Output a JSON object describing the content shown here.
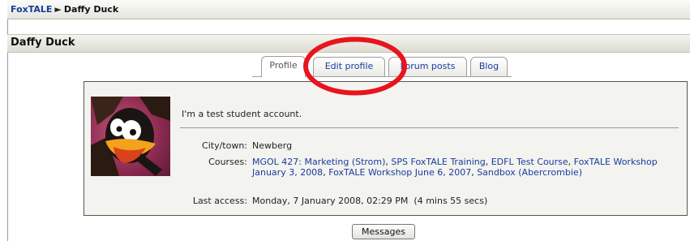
{
  "breadcrumb": {
    "root": "FoxTALE",
    "separator": "►",
    "current": "Daffy Duck"
  },
  "heading": "Daffy Duck",
  "tabs": [
    {
      "label": "Profile",
      "active": true
    },
    {
      "label": "Edit profile",
      "active": false
    },
    {
      "label": "Forum posts",
      "active": false
    },
    {
      "label": "Blog",
      "active": false
    }
  ],
  "profile": {
    "description": "I'm a test student account.",
    "city_label": "City/town:",
    "city_value": "Newberg",
    "courses_label": "Courses:",
    "courses": [
      "MGOL 427: Marketing (Strom)",
      "SPS FoxTALE Training",
      "EDFL Test Course",
      "FoxTALE Workshop January 3, 2008",
      "FoxTALE Workshop June 6, 2007",
      "Sandbox (Abercrombie)"
    ],
    "last_access_label": "Last access:",
    "last_access_value": "Monday, 7 January 2008, 02:29 PM  (4 mins 55 secs)"
  },
  "messages_button": "Messages",
  "colors": {
    "link": "#1a3ca0",
    "annotation": "#e8141e"
  }
}
